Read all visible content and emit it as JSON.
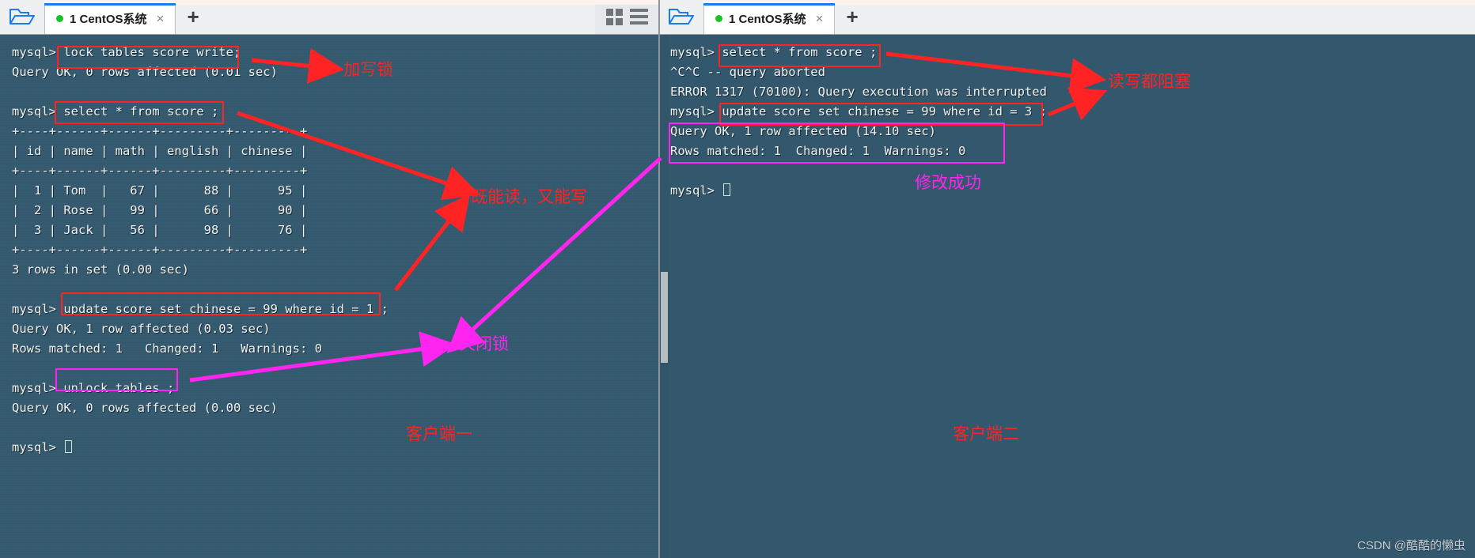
{
  "window_left": {
    "tab": {
      "label": "1 CentOS系统",
      "dot_color": "#16c423",
      "close_glyph": "×"
    },
    "new_tab_glyph": "+",
    "folder_icon": "folder-open-icon",
    "view_icons": [
      "grid-view-icon",
      "list-view-icon"
    ],
    "terminal_lines": [
      "mysql> lock tables score write;",
      "Query OK, 0 rows affected (0.01 sec)",
      "",
      "mysql> select * from score ;",
      "+----+------+------+---------+---------+",
      "| id | name | math | english | chinese |",
      "+----+------+------+---------+---------+",
      "|  1 | Tom  |   67 |      88 |      95 |",
      "|  2 | Rose |   99 |      66 |      90 |",
      "|  3 | Jack |   56 |      98 |      76 |",
      "+----+------+------+---------+---------+",
      "3 rows in set (0.00 sec)",
      "",
      "mysql> update score set chinese = 99 where id = 1 ;",
      "Query OK, 1 row affected (0.03 sec)",
      "Rows matched: 1   Changed: 1   Warnings: 0",
      "",
      "mysql> unlock tables ;",
      "Query OK, 0 rows affected (0.00 sec)",
      "",
      "mysql> "
    ],
    "annotations": [
      {
        "text": "加写锁",
        "color": "#ff2323"
      },
      {
        "text": "既能读，又能写",
        "color": "#ff2323"
      },
      {
        "text": "关闭锁",
        "color": "#ff25f0"
      },
      {
        "text": "客户端一",
        "color": "#ff2323"
      }
    ]
  },
  "window_right": {
    "tab": {
      "label": "1 CentOS系统",
      "dot_color": "#16c423",
      "close_glyph": "×"
    },
    "new_tab_glyph": "+",
    "folder_icon": "folder-open-icon",
    "terminal_lines": [
      "mysql> select * from score ;",
      "^C^C -- query aborted",
      "ERROR 1317 (70100): Query execution was interrupted",
      "mysql> update score set chinese = 99 where id = 3 ;",
      "Query OK, 1 row affected (14.10 sec)",
      "Rows matched: 1  Changed: 1  Warnings: 0",
      "",
      "mysql> "
    ],
    "annotations": [
      {
        "text": "读写都阻塞",
        "color": "#ff2323"
      },
      {
        "text": "修改成功",
        "color": "#ff25f0"
      },
      {
        "text": "客户端二",
        "color": "#ff2323"
      }
    ]
  },
  "watermark": "CSDN @酷酷的懒虫",
  "colors": {
    "terminal_bg": "#33586e",
    "tab_active_bar": "#1b7ced",
    "annotation_red": "#ff2323",
    "annotation_magenta": "#ff25f0",
    "prompt_text": "#f2f2f2"
  }
}
